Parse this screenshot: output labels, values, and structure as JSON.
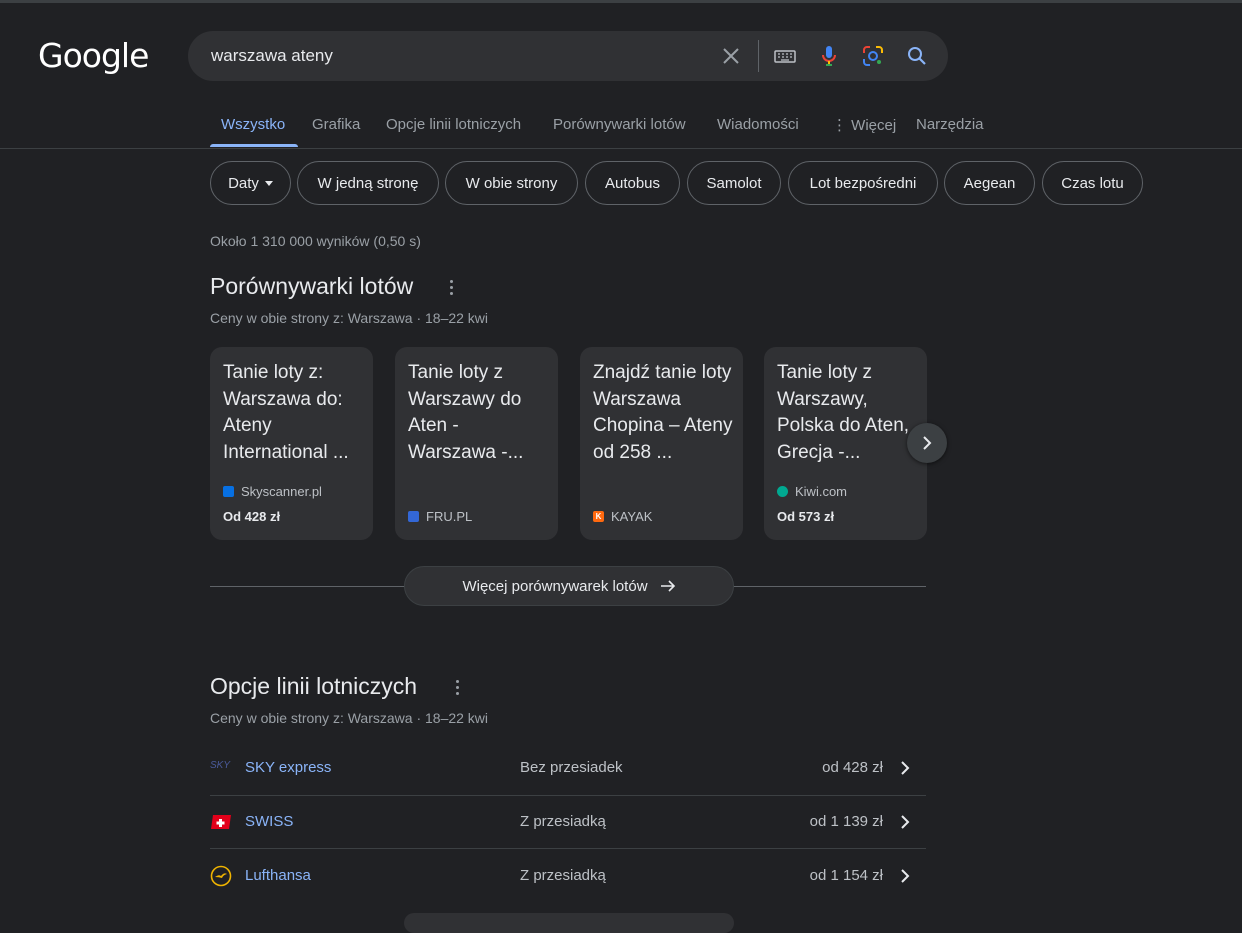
{
  "logo": "Google",
  "search": {
    "query": "warszawa ateny",
    "icons": [
      "clear-icon",
      "keyboard-icon",
      "microphone-icon",
      "lens-icon",
      "search-icon"
    ]
  },
  "tabs": [
    {
      "label": "Wszystko",
      "active": true
    },
    {
      "label": "Grafika"
    },
    {
      "label": "Opcje linii lotniczych"
    },
    {
      "label": "Porównywarki lotów"
    },
    {
      "label": "Wiadomości"
    },
    {
      "label": "Więcej"
    },
    {
      "label": "Narzędzia"
    }
  ],
  "chips": [
    "Daty",
    "W jedną stronę",
    "W obie strony",
    "Autobus",
    "Samolot",
    "Lot bezpośredni",
    "Aegean",
    "Czas lotu"
  ],
  "stats": "Około 1 310 000 wyników (0,50 s)",
  "comparators": {
    "title": "Porównywarki lotów",
    "subtitle": "Ceny w obie strony z: Warszawa · 18–22 kwi",
    "cards": [
      {
        "title": "Tanie loty z: Warszawa do: Ateny International ...",
        "source": "Skyscanner.pl",
        "price": "Od 428 zł",
        "fav_color": "#0770e3"
      },
      {
        "title": "Tanie loty z Warszawy do Aten - Warszawa -...",
        "source": "FRU.PL",
        "price": "",
        "fav_color": "#3367d6"
      },
      {
        "title": "Znajdź tanie loty Warszawa Chopina – Ateny od 258 ...",
        "source": "KAYAK",
        "price": "",
        "fav_color": "#ff690f"
      },
      {
        "title": "Tanie loty z Warszawy, Polska do Aten, Grecja -...",
        "source": "Kiwi.com",
        "price": "Od 573 zł",
        "fav_color": "#00a991"
      }
    ],
    "more_label": "Więcej porównywarek lotów"
  },
  "airlines": {
    "title": "Opcje linii lotniczych",
    "subtitle": "Ceny w obie strony z: Warszawa · 18–22 kwi",
    "rows": [
      {
        "name": "SKY express",
        "stops": "Bez przesiadek",
        "price": "od 428 zł",
        "logo_text": "SKY"
      },
      {
        "name": "SWISS",
        "stops": "Z przesiadką",
        "price": "od 1 139 zł"
      },
      {
        "name": "Lufthansa",
        "stops": "Z przesiadką",
        "price": "od 1 154 zł"
      }
    ]
  }
}
